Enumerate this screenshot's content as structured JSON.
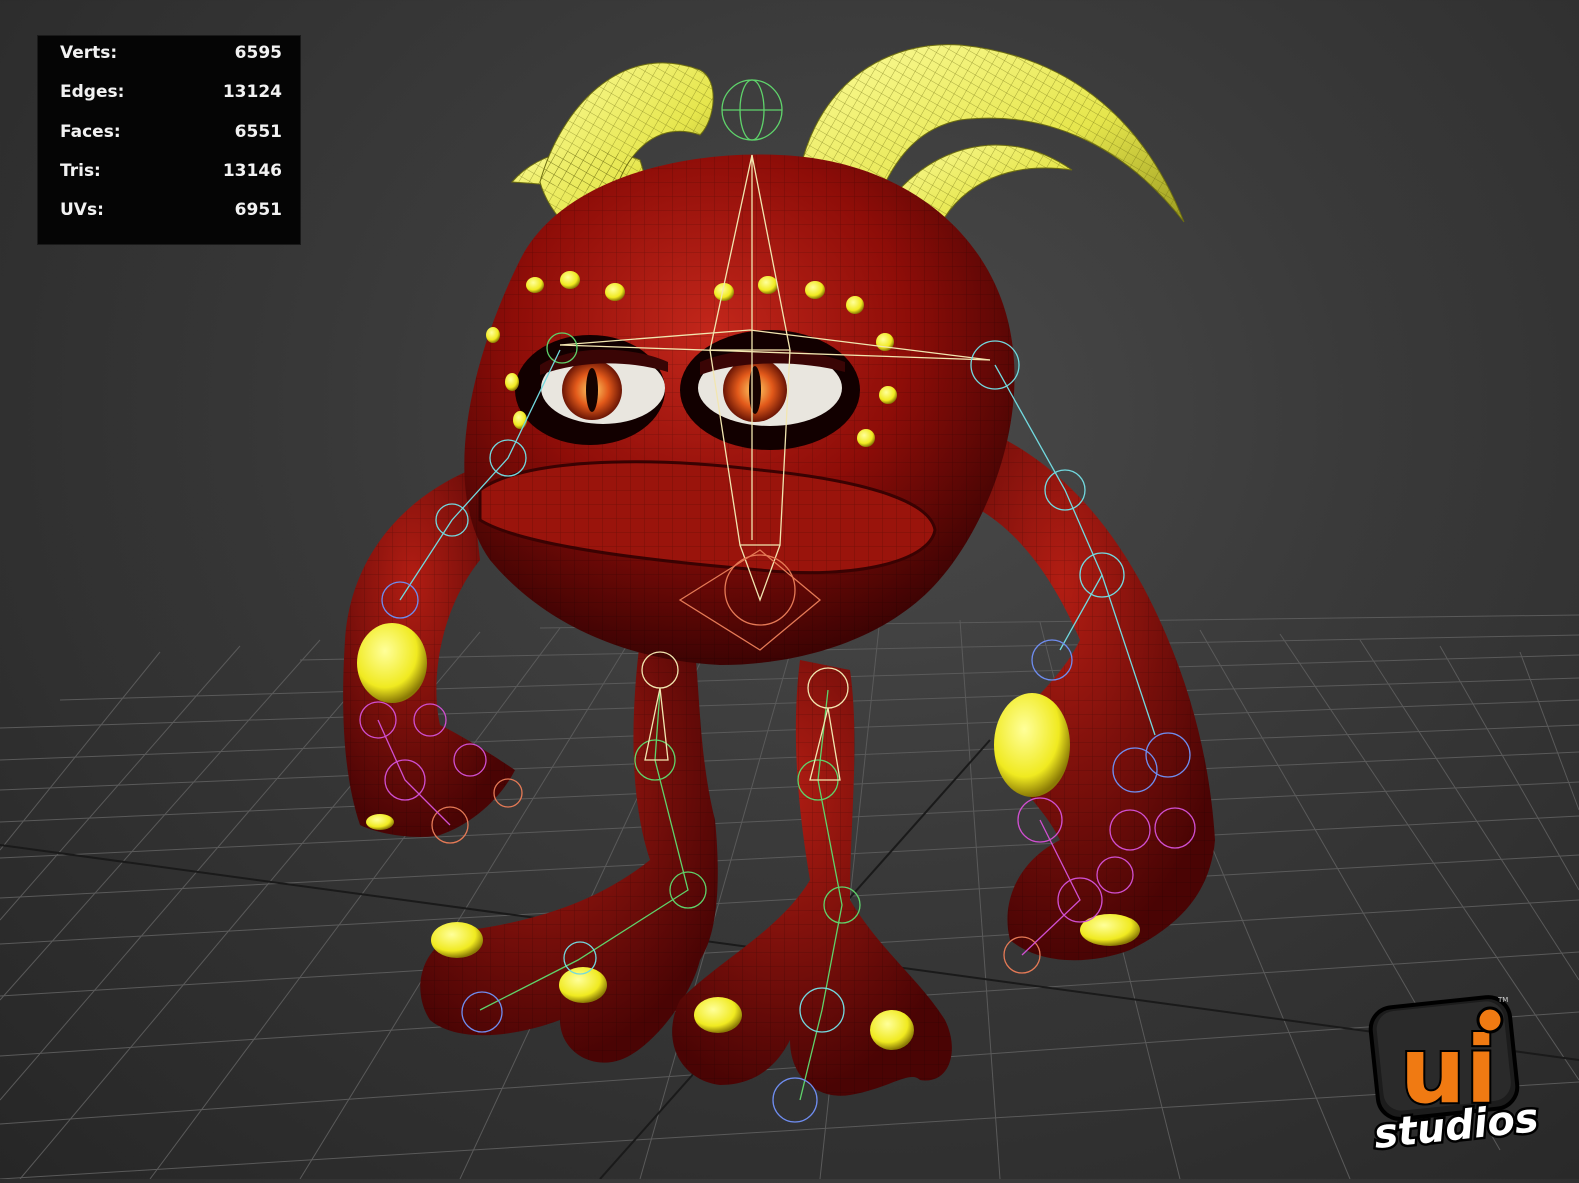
{
  "stats": [
    {
      "label": "Verts:",
      "value": "6595"
    },
    {
      "label": "Edges:",
      "value": "13124"
    },
    {
      "label": "Faces:",
      "value": "6551"
    },
    {
      "label": "Tris:",
      "value": "13146"
    },
    {
      "label": "UVs:",
      "value": "6951"
    }
  ],
  "logo": {
    "mark": "ui",
    "word": "studios",
    "tm": "TM"
  },
  "colors": {
    "background": "#333333",
    "grid": "#555555",
    "skin": "#8e0d08",
    "horns": "#eef06a",
    "spots": "#f5f03a",
    "logo_orange": "#f07a12"
  }
}
